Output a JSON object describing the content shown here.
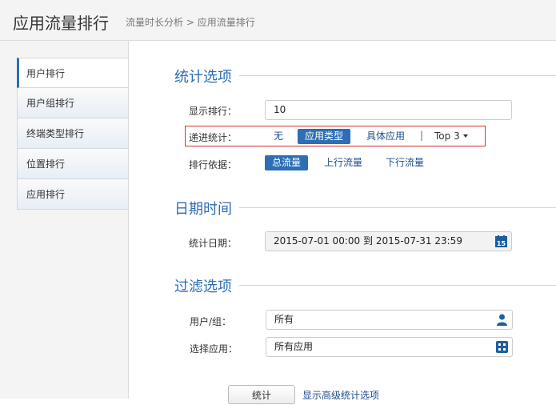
{
  "header": {
    "title": "应用流量排行",
    "breadcrumb": [
      "流量时长分析",
      "应用流量排行"
    ],
    "breadcrumb_sep": ">"
  },
  "nav": {
    "items": [
      {
        "label": "用户排行",
        "active": true
      },
      {
        "label": "用户组排行",
        "active": false
      },
      {
        "label": "终端类型排行",
        "active": false
      },
      {
        "label": "位置排行",
        "active": false
      },
      {
        "label": "应用排行",
        "active": false
      }
    ]
  },
  "stats": {
    "section_title": "统计选项",
    "display_label": "显示排行：",
    "display_value": "10",
    "drill_label": "递进统计：",
    "drill_options": [
      "无",
      "应用类型",
      "具体应用"
    ],
    "drill_selected": "应用类型",
    "drill_sep": "|",
    "top_select": "Top 3",
    "basis_label": "排行依据：",
    "basis_options": [
      "总流量",
      "上行流量",
      "下行流量"
    ],
    "basis_selected": "总流量"
  },
  "date": {
    "section_title": "日期时间",
    "label": "统计日期：",
    "start": "2015-07-01 00:00",
    "to": "到",
    "end": "2015-07-31 23:59",
    "calendar_day": "15"
  },
  "filter": {
    "section_title": "过滤选项",
    "user_label": "用户/组：",
    "user_value": "所有",
    "app_label": "选择应用：",
    "app_value": "所有应用"
  },
  "actions": {
    "submit_label": "统计",
    "advanced_link": "显示高级统计选项"
  },
  "colors": {
    "accent": "#2d6eb5",
    "highlight_border": "#e03030"
  }
}
